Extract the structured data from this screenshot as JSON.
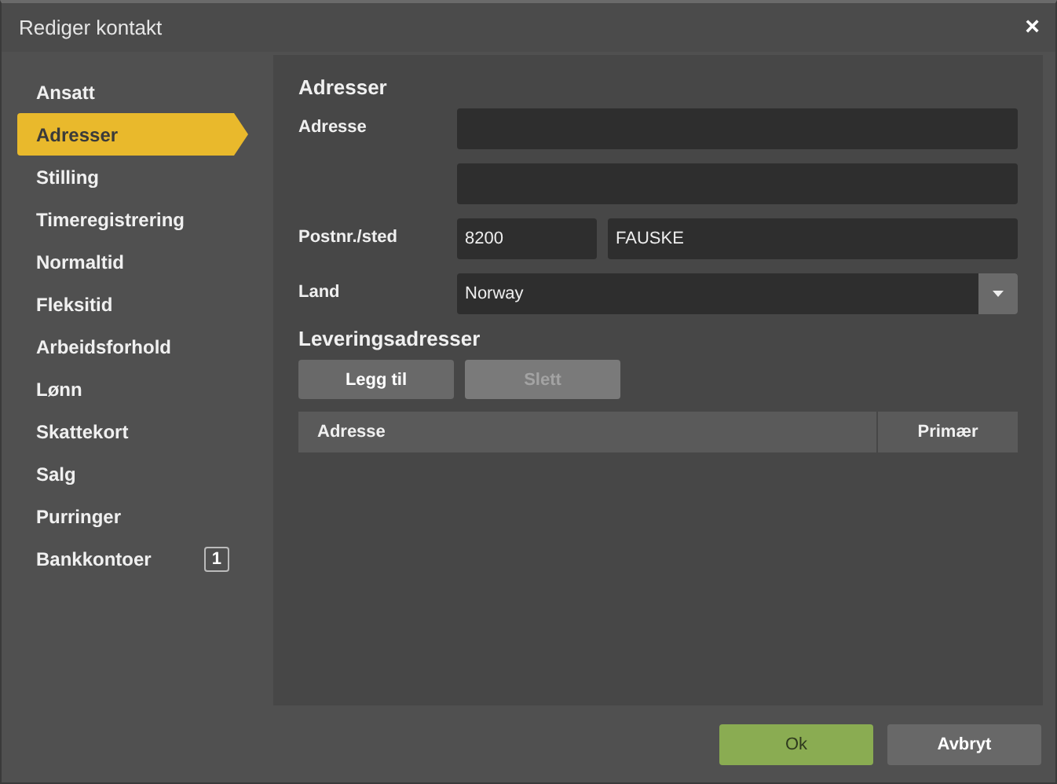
{
  "window": {
    "title": "Rediger kontakt",
    "close": "×"
  },
  "sidebar": {
    "items": [
      {
        "label": "Ansatt",
        "selected": false
      },
      {
        "label": "Adresser",
        "selected": true
      },
      {
        "label": "Stilling",
        "selected": false
      },
      {
        "label": "Timeregistrering",
        "selected": false
      },
      {
        "label": "Normaltid",
        "selected": false
      },
      {
        "label": "Fleksitid",
        "selected": false
      },
      {
        "label": "Arbeidsforhold",
        "selected": false
      },
      {
        "label": "Lønn",
        "selected": false
      },
      {
        "label": "Skattekort",
        "selected": false
      },
      {
        "label": "Salg",
        "selected": false
      },
      {
        "label": "Purringer",
        "selected": false
      },
      {
        "label": "Bankkontoer",
        "selected": false,
        "badge": "1"
      }
    ]
  },
  "form": {
    "title": "Adresser",
    "address": {
      "label": "Adresse"
    },
    "postal": {
      "label": "Postnr./sted",
      "postcode": "8200",
      "city": "FAUSKE"
    },
    "country": {
      "label": "Land",
      "value": "Norway"
    }
  },
  "delivery": {
    "title": "Leveringsadresser",
    "buttons": [
      {
        "label": "Legg til",
        "disabled": false
      },
      {
        "label": "Slett",
        "disabled": true
      }
    ],
    "table": {
      "columns": [
        "Adresse",
        "Primær"
      ]
    }
  },
  "footer": {
    "buttons": [
      {
        "label": "Ok",
        "kind": "primary"
      },
      {
        "label": "Avbryt",
        "kind": "secondary"
      }
    ]
  }
}
